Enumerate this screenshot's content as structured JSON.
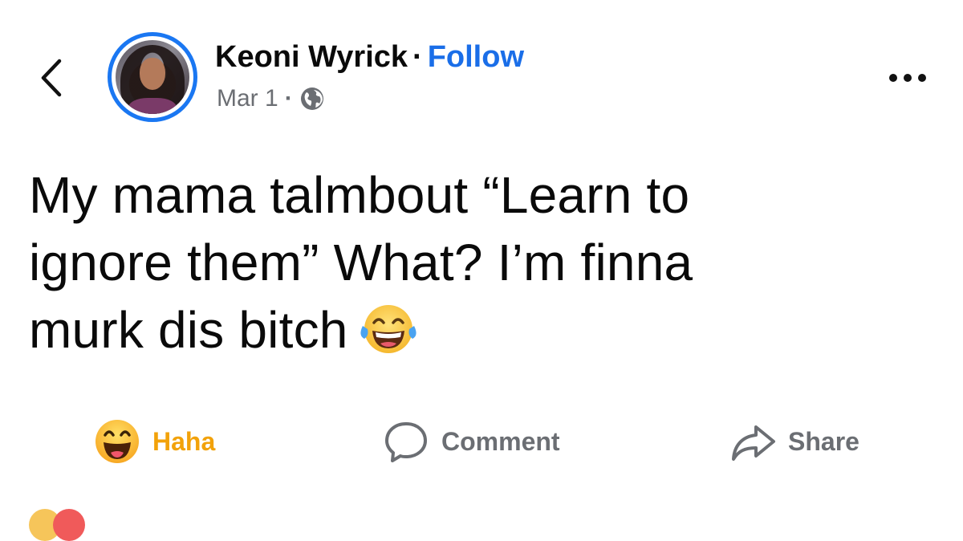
{
  "header": {
    "author_name": "Keoni Wyrick",
    "separator": "·",
    "follow_label": "Follow",
    "date": "Mar 1",
    "meta_separator": "·",
    "audience_icon": "globe-icon",
    "back_icon": "chevron-left-icon",
    "more_icon": "more-horizontal-icon"
  },
  "post": {
    "lines": [
      "My mama talmbout “Learn to",
      "ignore them” What? I’m finna",
      "murk dis bitch"
    ],
    "trailing_emoji": "laughing-tears-emoji"
  },
  "actions": {
    "haha_label": "Haha",
    "comment_label": "Comment",
    "share_label": "Share",
    "haha_icon": "haha-reaction-icon",
    "comment_icon": "comment-bubble-icon",
    "share_icon": "share-arrow-icon"
  },
  "colors": {
    "accent": "#1a6ee8",
    "avatar_ring": "#1a77f2",
    "haha": "#f2a20a",
    "muted": "#6b6e73",
    "text": "#0a0a0a"
  }
}
